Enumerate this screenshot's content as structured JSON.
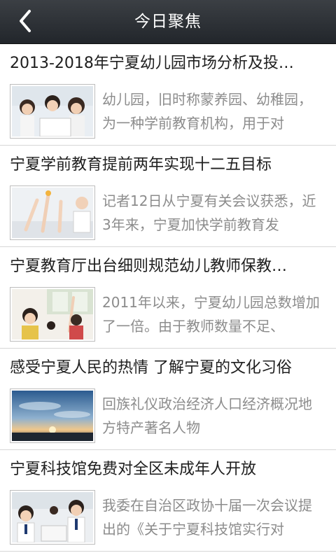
{
  "header": {
    "title": "今日聚焦",
    "back_icon": "chevron-left-icon"
  },
  "articles": [
    {
      "title": "2013-2018年宁夏幼儿园市场分析及投…",
      "summary": "幼儿园，旧时称蒙养园、幼稚园，为一种学前教育机构，用于对",
      "thumb": "kids-at-laptop-image"
    },
    {
      "title": "宁夏学前教育提前两年实现十二五目标",
      "summary": "记者12日从宁夏有关会议获悉，近3年来，宁夏加快学前教育发",
      "thumb": "children-raising-hands-image"
    },
    {
      "title": "宁夏教育厅出台细则规范幼儿教师保教…",
      "summary": "2011年以来，宁夏幼儿园总数增加了一倍。由于教师数量不足、",
      "thumb": "classroom-children-image"
    },
    {
      "title": "感受宁夏人民的热情 了解宁夏的文化习俗",
      "summary": "回族礼仪政治经济人口经济概况地方特产著名人物",
      "thumb": "sunset-horizon-image"
    },
    {
      "title": "宁夏科技馆免费对全区未成年人开放",
      "summary": "我委在自治区政协十届一次会议提出的《关于宁夏科技馆实行对",
      "thumb": "students-in-uniform-image"
    }
  ]
}
